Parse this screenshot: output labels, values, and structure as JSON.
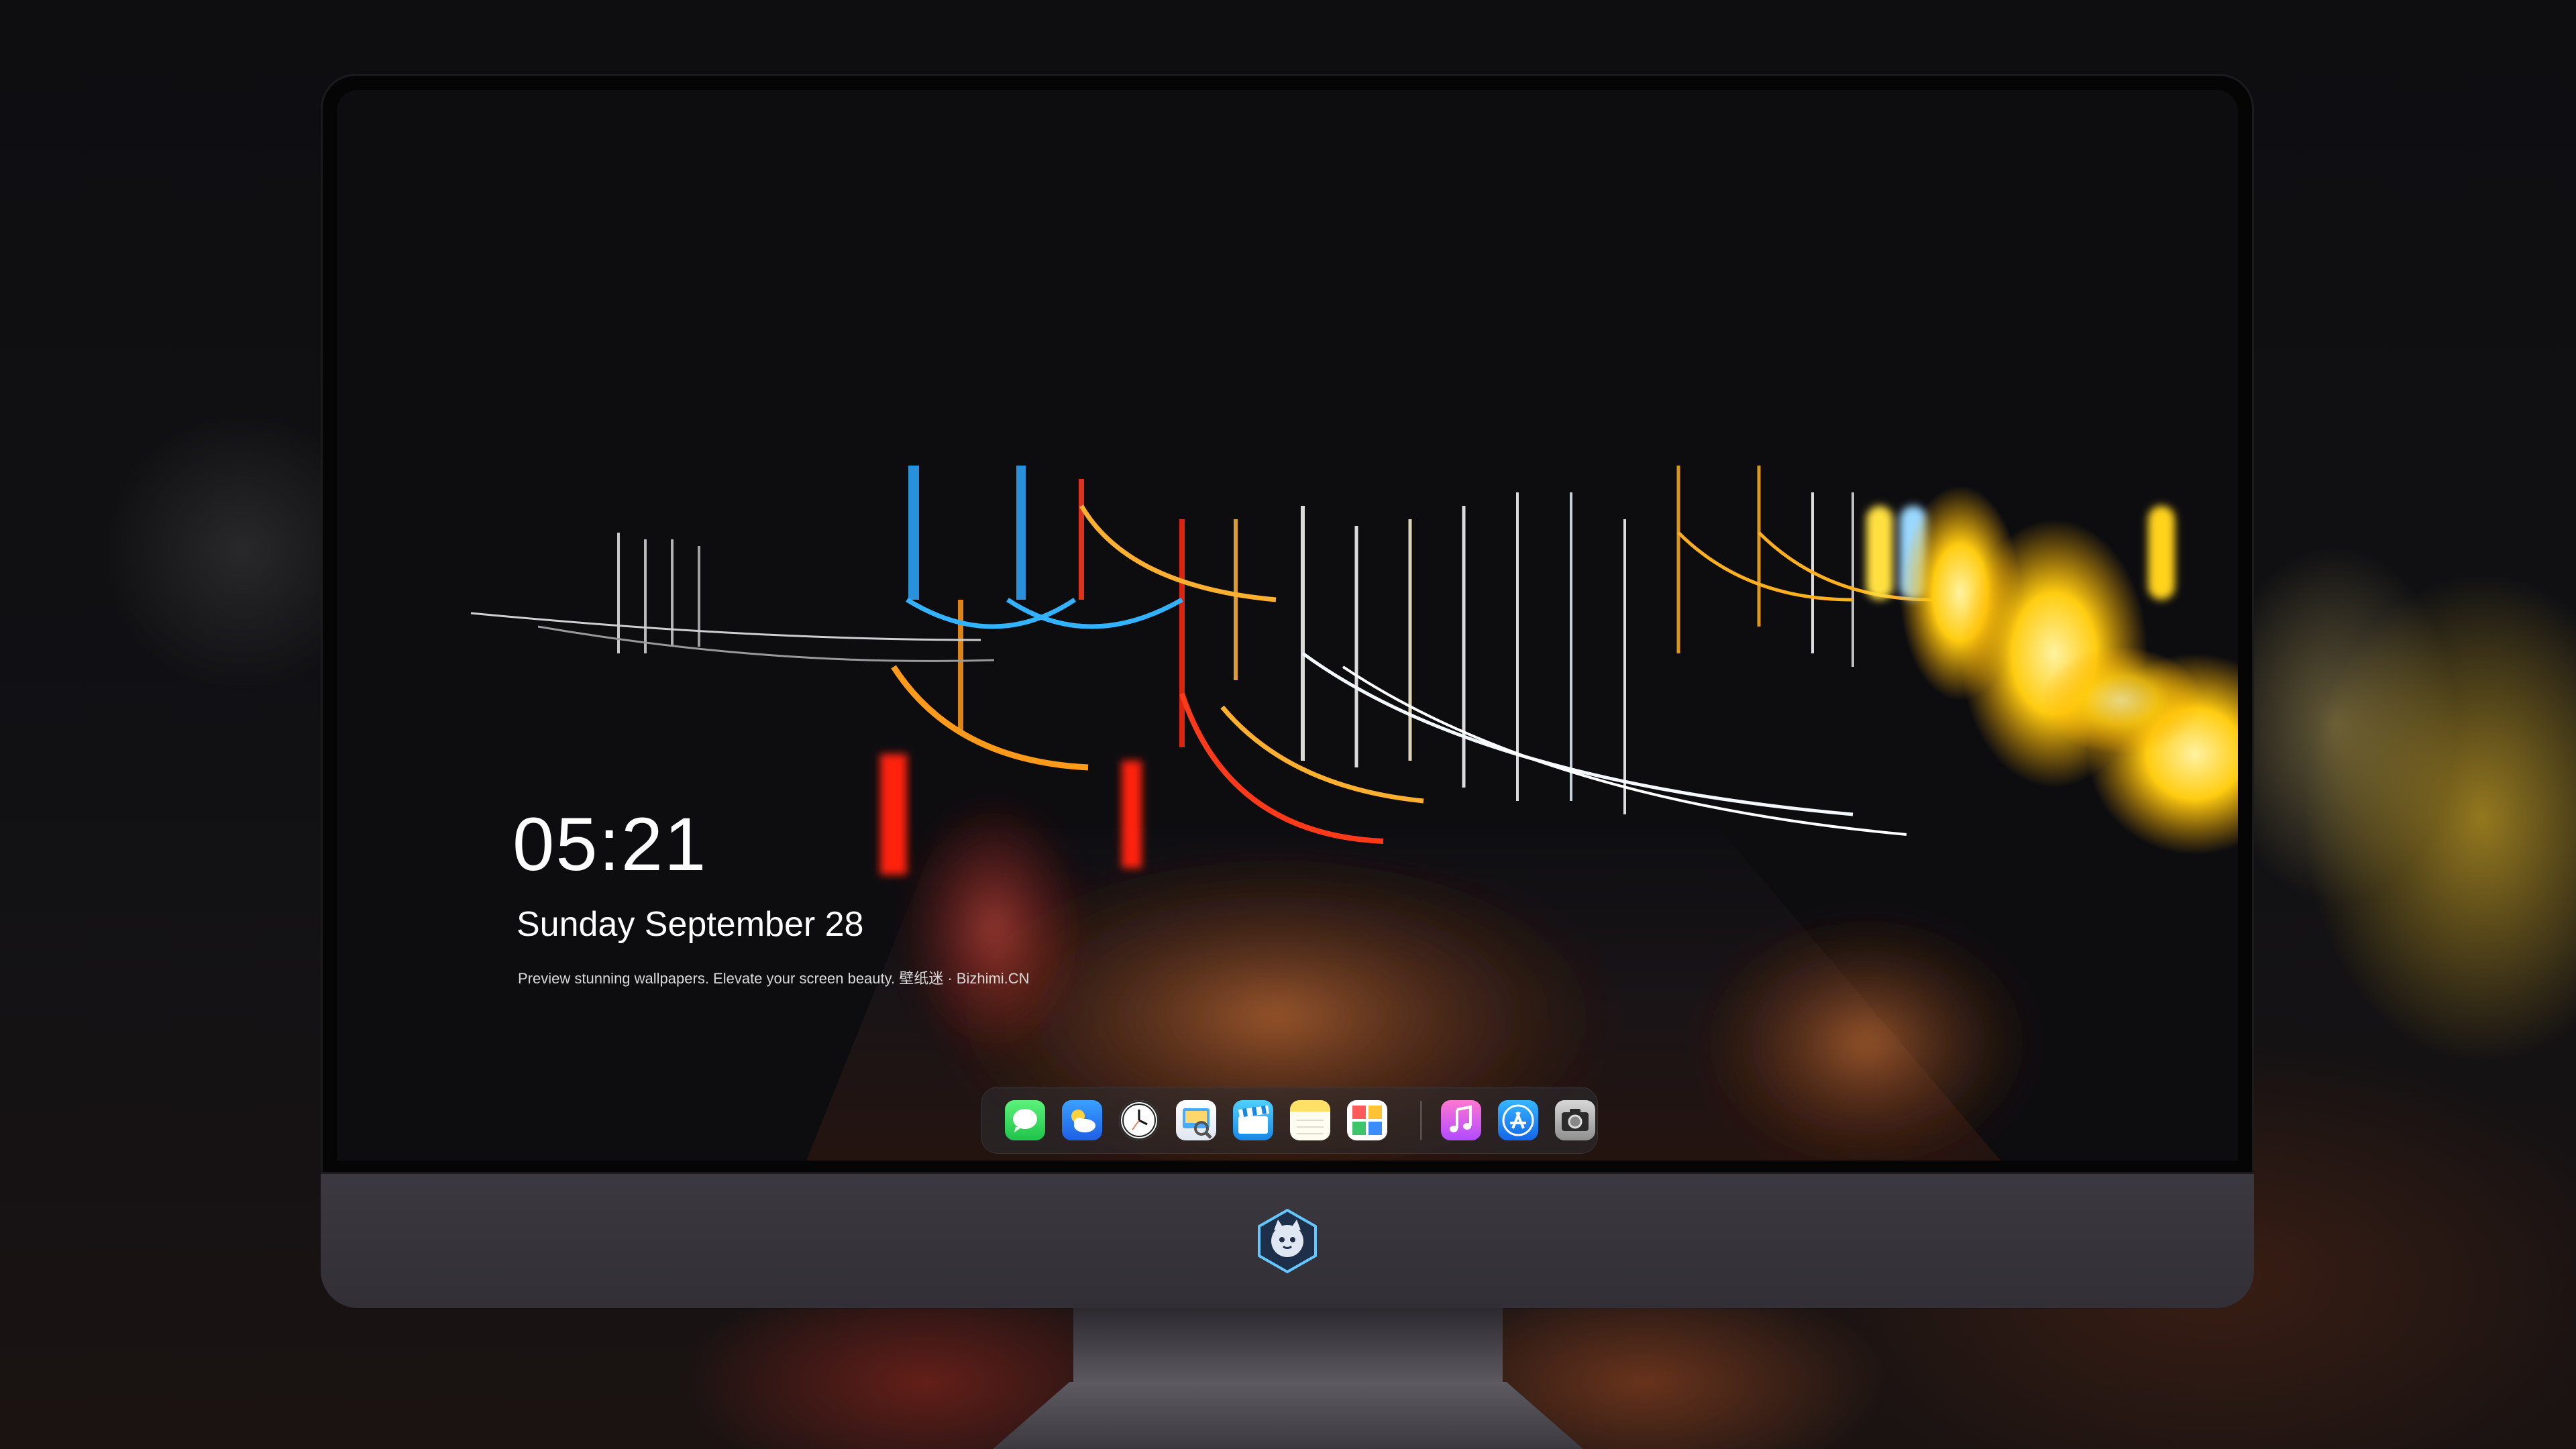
{
  "lockscreen": {
    "time": "05:21",
    "date": "Sunday September  28",
    "tagline": "Preview stunning wallpapers. Elevate your screen beauty. 壁纸迷 · Bizhimi.CN"
  },
  "dock": {
    "apps": [
      {
        "name": "messages",
        "icon": "messages-icon",
        "color": "#34d058"
      },
      {
        "name": "weather",
        "icon": "weather-icon",
        "color": "#2f86f5"
      },
      {
        "name": "clock",
        "icon": "clock-icon",
        "color": "#f3f3f3"
      },
      {
        "name": "preview",
        "icon": "preview-icon",
        "color": "#dfe7f2"
      },
      {
        "name": "clips",
        "icon": "clapperboard-icon",
        "color": "#2aa4f4"
      },
      {
        "name": "notes",
        "icon": "notes-icon",
        "color": "#ffe067"
      },
      {
        "name": "photos",
        "icon": "photos-icon",
        "color": "#ffffff"
      },
      {
        "name": "music",
        "icon": "music-icon",
        "color": "#e55cf0"
      },
      {
        "name": "app-store",
        "icon": "app-store-icon",
        "color": "#1f8ef5"
      },
      {
        "name": "camera",
        "icon": "camera-icon",
        "color": "#9a9a9a"
      }
    ]
  },
  "monitor": {
    "chin_logo": "mascot-logo-icon",
    "frame_color": "#050506",
    "chin_color": "#36333b"
  }
}
